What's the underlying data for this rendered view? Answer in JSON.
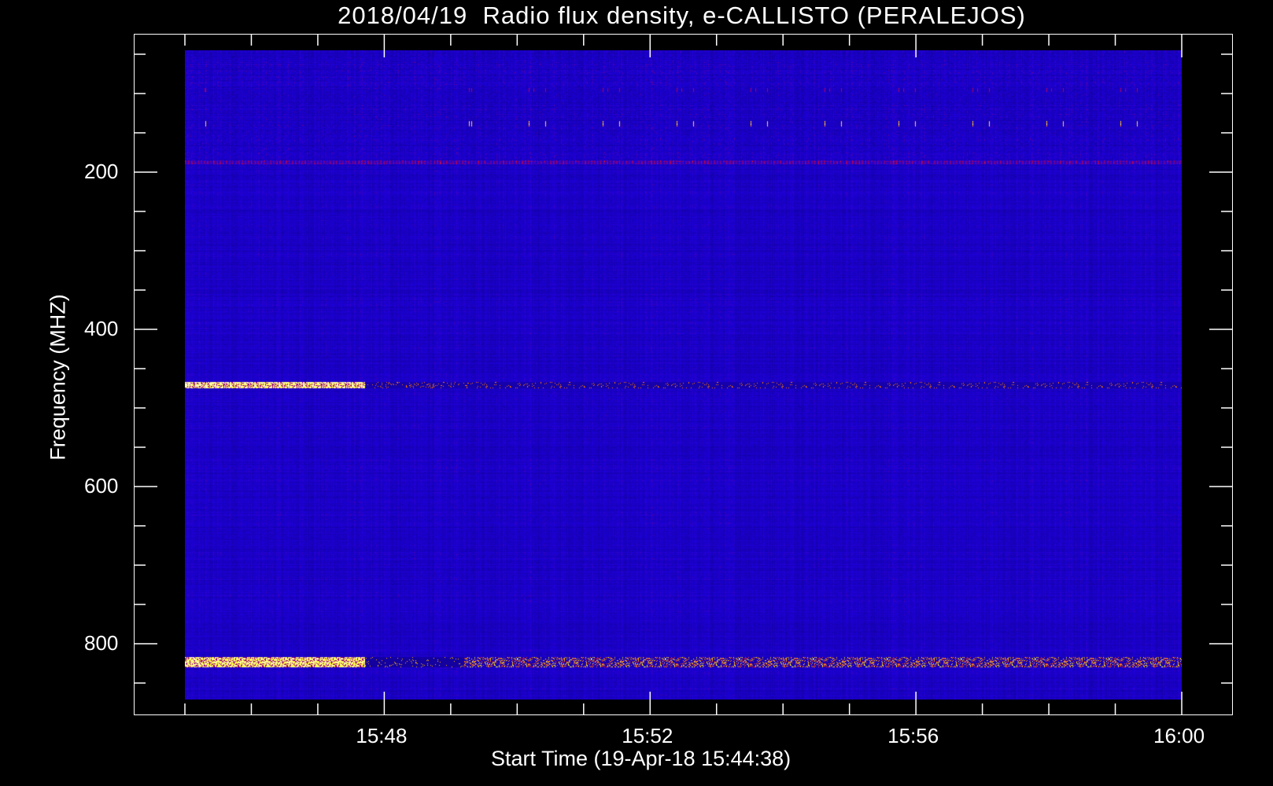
{
  "chart_data": {
    "type": "heatmap",
    "title": "2018/04/19  Radio flux density, e-CALLISTO (PERALEJOS)",
    "xlabel": "Start Time (19-Apr-18 15:44:38)",
    "ylabel": "Frequency (MHZ)",
    "x_ticks": [
      {
        "minutes": 15.0,
        "label": ""
      },
      {
        "minutes": 16.0,
        "label": ""
      },
      {
        "minutes": 17.0,
        "label": ""
      },
      {
        "minutes": 18.0,
        "label": "15:48"
      },
      {
        "minutes": 19.0,
        "label": ""
      },
      {
        "minutes": 20.0,
        "label": ""
      },
      {
        "minutes": 21.0,
        "label": ""
      },
      {
        "minutes": 22.0,
        "label": "15:52"
      },
      {
        "minutes": 23.0,
        "label": ""
      },
      {
        "minutes": 24.0,
        "label": ""
      },
      {
        "minutes": 25.0,
        "label": ""
      },
      {
        "minutes": 26.0,
        "label": "15:56"
      },
      {
        "minutes": 27.0,
        "label": ""
      },
      {
        "minutes": 28.0,
        "label": ""
      },
      {
        "minutes": 29.0,
        "label": ""
      },
      {
        "minutes": 30.0,
        "label": "16:00"
      }
    ],
    "x_range_minutes_after_15_30": [
      15.0,
      30.0
    ],
    "y_ticks": [
      {
        "value": 50,
        "label": ""
      },
      {
        "value": 100,
        "label": ""
      },
      {
        "value": 150,
        "label": ""
      },
      {
        "value": 200,
        "label": "200"
      },
      {
        "value": 250,
        "label": ""
      },
      {
        "value": 300,
        "label": ""
      },
      {
        "value": 350,
        "label": ""
      },
      {
        "value": 400,
        "label": "400"
      },
      {
        "value": 450,
        "label": ""
      },
      {
        "value": 500,
        "label": ""
      },
      {
        "value": 550,
        "label": ""
      },
      {
        "value": 600,
        "label": "600"
      },
      {
        "value": 650,
        "label": ""
      },
      {
        "value": 700,
        "label": ""
      },
      {
        "value": 750,
        "label": ""
      },
      {
        "value": 800,
        "label": "800"
      },
      {
        "value": 850,
        "label": ""
      }
    ],
    "y_range_mhz": [
      45,
      871
    ],
    "y_inverted": true,
    "colormap": "blue-red-yellow-white",
    "background_intensity": "low",
    "bands_mhz": [
      {
        "freq": 138,
        "intensity": "medium",
        "sporadic": true
      },
      {
        "freq": 187,
        "intensity": "medium"
      },
      {
        "freq": 470,
        "intensity": "high-early"
      },
      {
        "freq": 823,
        "intensity": "high"
      }
    ]
  },
  "colors": {
    "background": "#000000",
    "axes": "#ffffff",
    "base": "#1010c8"
  }
}
